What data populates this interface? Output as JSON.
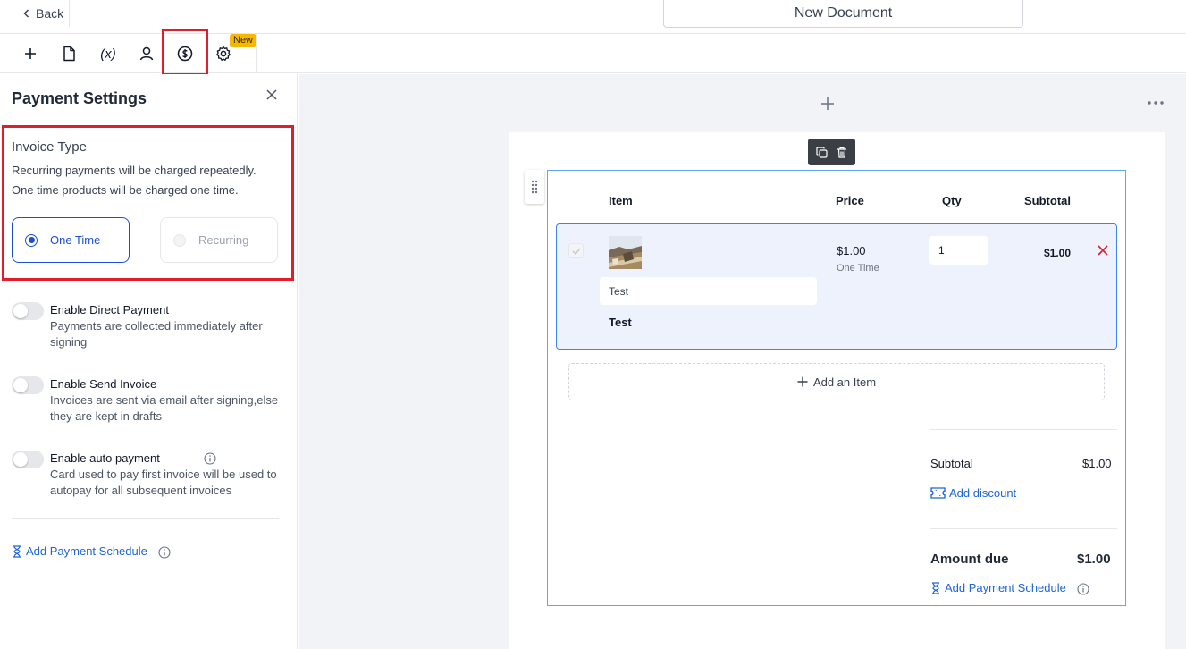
{
  "header": {
    "back_label": "Back",
    "document_title": "New Document"
  },
  "toolbar": {
    "items": [
      {
        "icon": "plus-icon"
      },
      {
        "icon": "document-icon"
      },
      {
        "icon": "variables-icon",
        "label": "(x)"
      },
      {
        "icon": "user-icon"
      },
      {
        "icon": "dollar-circle-icon",
        "active": true
      },
      {
        "icon": "gear-icon",
        "badge": "New"
      }
    ],
    "highlight_color": "#e11d2a",
    "badge_color": "#f5b800"
  },
  "sidebar": {
    "title": "Payment Settings",
    "invoice_type": {
      "title": "Invoice Type",
      "desc_1": "Recurring payments will be charged repeatedly.",
      "desc_2": "One time products will be charged one time.",
      "options": [
        "One Time",
        "Recurring"
      ],
      "selected": "One Time"
    },
    "options": [
      {
        "title": "Enable Direct Payment",
        "desc": "Payments are collected immediately after signing",
        "enabled": false
      },
      {
        "title": "Enable Send Invoice",
        "desc": "Invoices are sent via email after signing,else they are kept in drafts",
        "enabled": false
      },
      {
        "title": "Enable auto payment",
        "desc": "Card used to pay first invoice will be used to autopay for all subsequent invoices",
        "enabled": false
      }
    ],
    "add_schedule": "Add Payment Schedule"
  },
  "table": {
    "headers": {
      "item": "Item",
      "price": "Price",
      "qty": "Qty",
      "subtotal": "Subtotal"
    },
    "rows": [
      {
        "description": "Test",
        "name": "Test",
        "price": "$1.00",
        "frequency": "One Time",
        "qty": "1",
        "subtotal": "$1.00"
      }
    ],
    "add_item": "Add an Item"
  },
  "summary": {
    "subtotal_label": "Subtotal",
    "subtotal_value": "$1.00",
    "add_discount": "Add discount",
    "amount_due_label": "Amount due",
    "amount_due_value": "$1.00",
    "add_schedule": "Add Payment Schedule"
  },
  "colors": {
    "accent": "#1d64d8",
    "delete": "#e11d2a"
  }
}
